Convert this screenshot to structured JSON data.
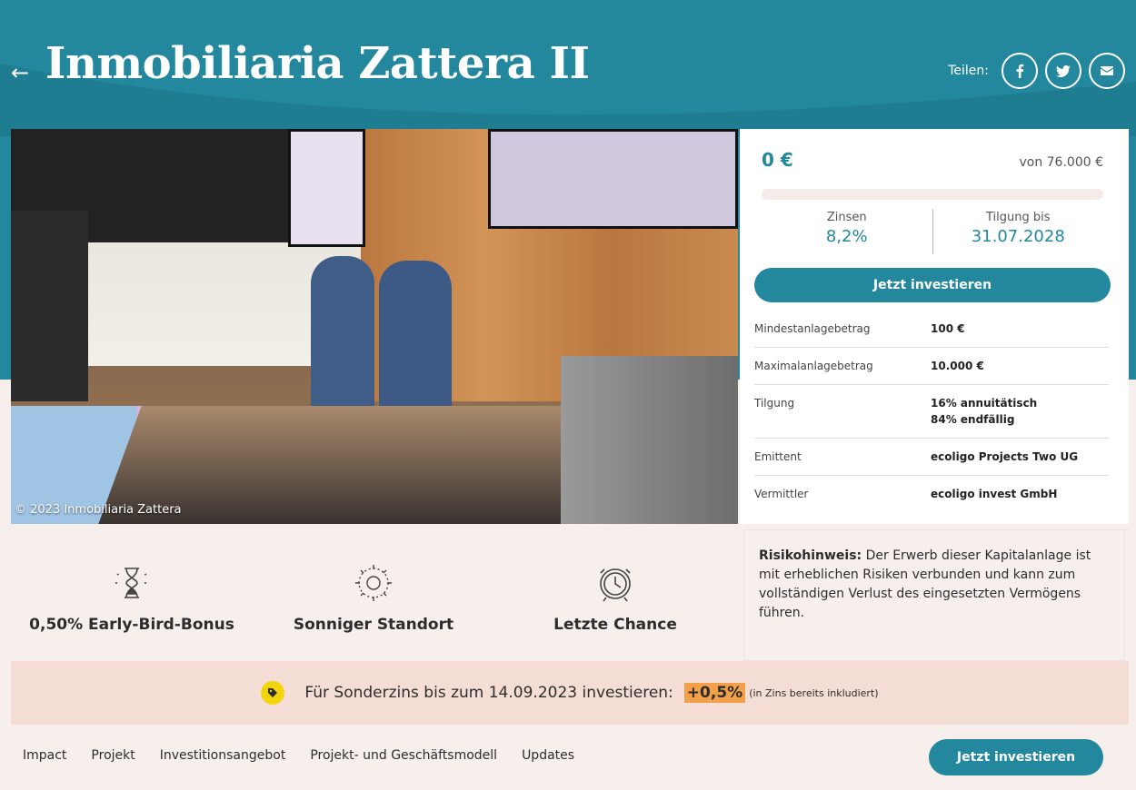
{
  "header": {
    "title": "Inmobiliaria Zattera II",
    "back_icon": "arrow-left-icon",
    "share_label": "Teilen:",
    "share_buttons": [
      {
        "icon": "facebook-icon"
      },
      {
        "icon": "twitter-icon"
      },
      {
        "icon": "mail-icon"
      }
    ],
    "brand_color": "#23879d"
  },
  "photo": {
    "credit": "© 2023 Inmobiliaria Zattera"
  },
  "invest": {
    "amount": "0 €",
    "goal": "von 76.000 €",
    "progress_fraction": 0,
    "stats": [
      {
        "label": "Zinsen",
        "value": "8,2%"
      },
      {
        "label": "Tilgung bis",
        "value": "31.07.2028"
      }
    ],
    "button_label": "Jetzt investieren",
    "details": [
      {
        "key": "Mindestanlagebetrag",
        "value": "100 €"
      },
      {
        "key": "Maximalanlagebetrag",
        "value": "10.000 €"
      },
      {
        "key": "Tilgung",
        "value": "16% annuitätisch",
        "value2": "84% endfällig"
      },
      {
        "key": "Emittent",
        "value": "ecoligo Projects Two UG"
      },
      {
        "key": "Vermittler",
        "value": "ecoligo invest GmbH"
      }
    ]
  },
  "features": [
    {
      "icon": "hourglass-icon",
      "label": "0,50% Early-Bird-Bonus"
    },
    {
      "icon": "sun-icon",
      "label": "Sonniger Standort"
    },
    {
      "icon": "alarm-clock-icon",
      "label": "Letzte Chance"
    }
  ],
  "risk": {
    "title": "Risikohinweis:",
    "text": " Der Erwerb dieser Kapitalanlage ist mit erheblichen Risiken verbunden und kann zum vollständigen Verlust des eingesetzten Vermögens führen."
  },
  "promo": {
    "icon": "tag-icon",
    "text": "Für Sonderzins bis zum 14.09.2023 investieren:",
    "bonus": "+0,5%",
    "note": "(in Zins bereits inkludiert)"
  },
  "bottom_nav": {
    "links": [
      "Impact",
      "Projekt",
      "Investitionsangebot",
      "Projekt- und Geschäftsmodell",
      "Updates"
    ],
    "button_label": "Jetzt investieren"
  }
}
